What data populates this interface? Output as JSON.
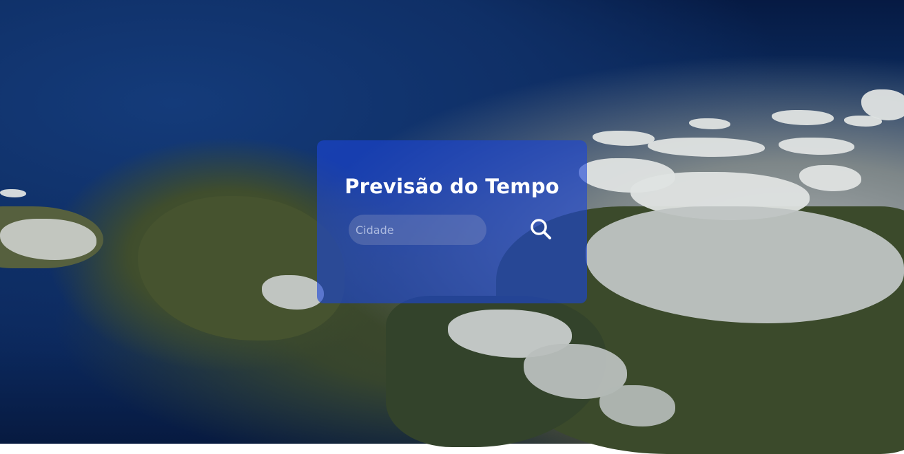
{
  "app": {
    "title": "Previsão do Tempo"
  },
  "search": {
    "placeholder": "Cidade",
    "value": "",
    "button_icon": "search-icon"
  },
  "colors": {
    "card_background": "rgba(27,69,215,0.62)",
    "text": "#ffffff"
  }
}
